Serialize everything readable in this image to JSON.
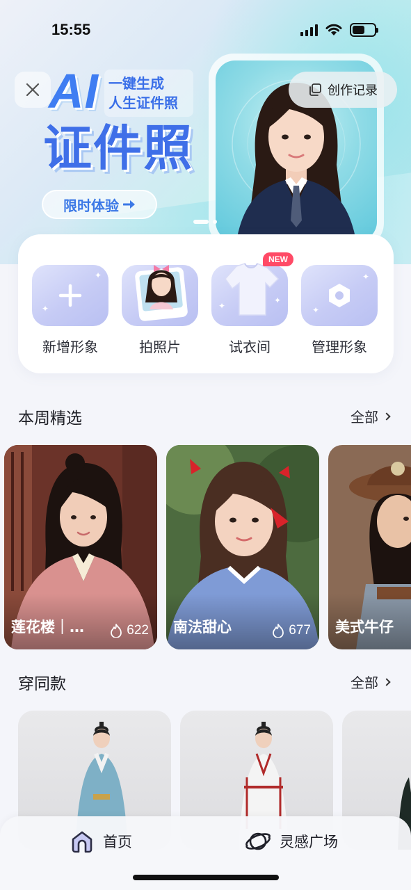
{
  "status_bar": {
    "time": "15:55"
  },
  "banner": {
    "title_ai": "AI",
    "tagline_line1": "一键生成",
    "tagline_line2": "人生证件照",
    "title_zh": "证件照",
    "cta_label": "限时体验",
    "record_label": "创作记录",
    "carousel_index": 1,
    "carousel_count": 2
  },
  "quick_actions": [
    {
      "label": "新增形象",
      "icon": "plus-icon"
    },
    {
      "label": "拍照片",
      "icon": "photo-frame-icon"
    },
    {
      "label": "试衣间",
      "icon": "tshirt-icon",
      "badge": "NEW"
    },
    {
      "label": "管理形象",
      "icon": "hexagon-settings-icon"
    }
  ],
  "weekly_picks": {
    "title": "本周精选",
    "all_label": "全部",
    "items": [
      {
        "name": "莲花楼｜…",
        "count": "622"
      },
      {
        "name": "南法甜心",
        "count": "677"
      },
      {
        "name": "美式牛仔",
        "count": ""
      }
    ]
  },
  "same_style": {
    "title": "穿同款",
    "all_label": "全部"
  },
  "bottom_nav": {
    "home_label": "首页",
    "inspiration_label": "灵感广场"
  },
  "colors": {
    "accent_blue": "#3f6fe8",
    "badge_red": "#ff4a66",
    "tile_purple": "#c6cbf5"
  }
}
